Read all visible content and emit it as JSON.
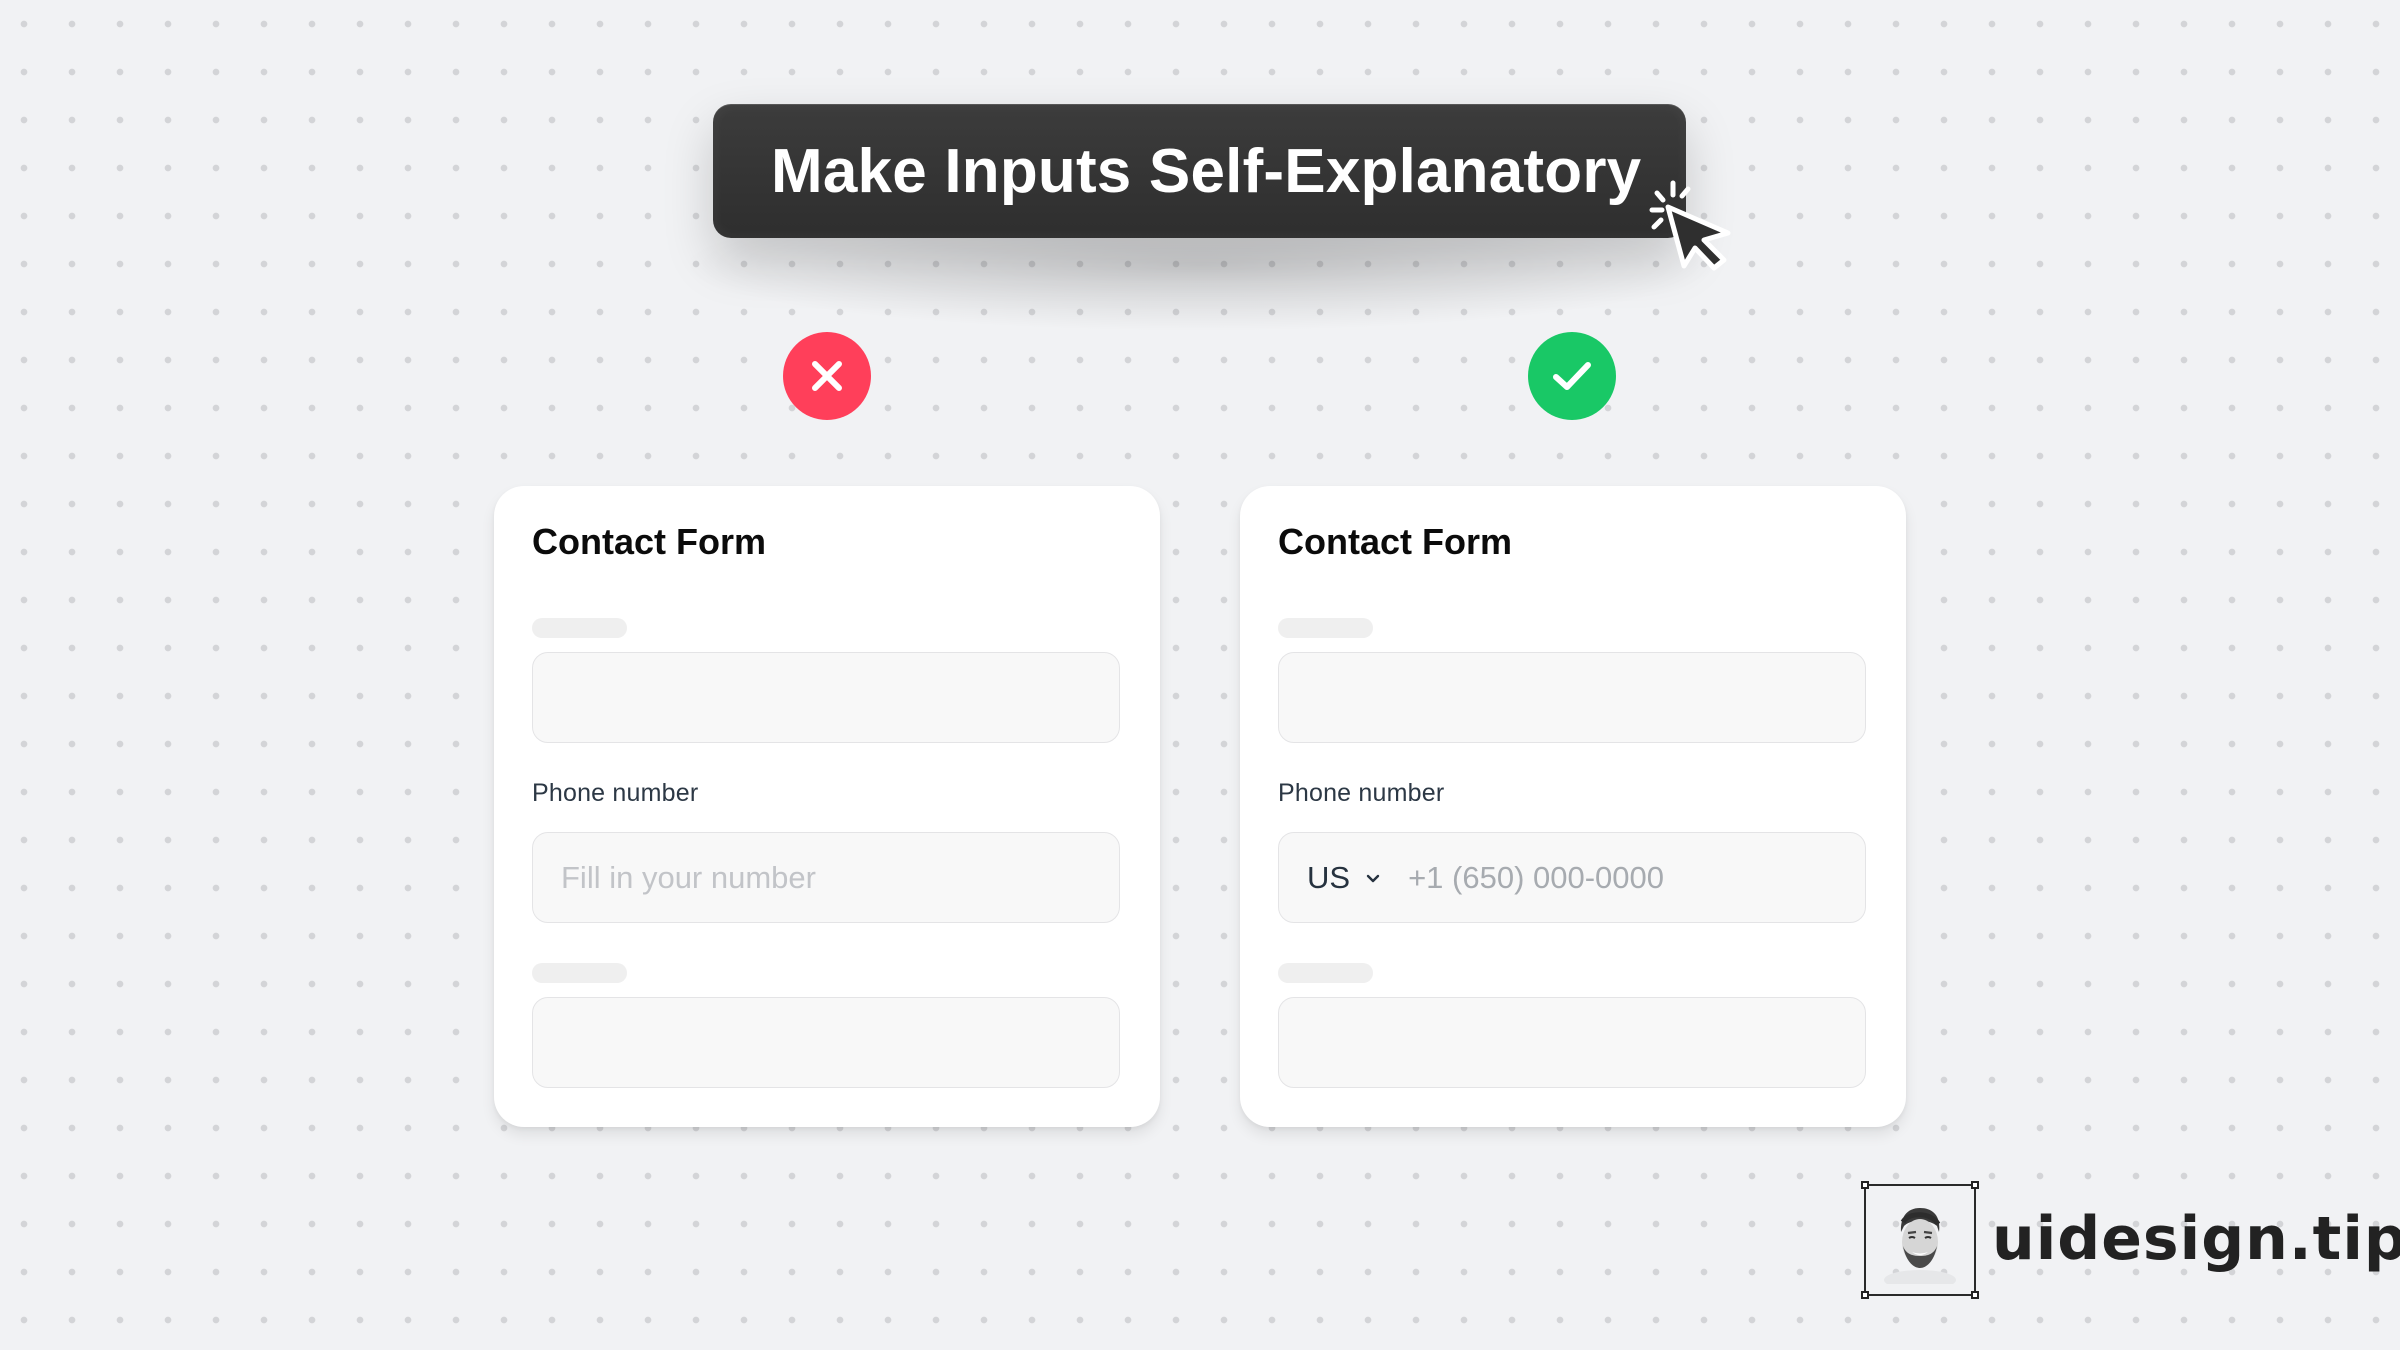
{
  "banner": {
    "title": "Make Inputs Self-Explanatory",
    "cursor_icon": "pointer-click-icon"
  },
  "badges": {
    "bad": {
      "icon": "x-icon",
      "meaning": "incorrect",
      "color": "#ff3f5a"
    },
    "good": {
      "icon": "check-icon",
      "meaning": "correct",
      "color": "#19c866"
    }
  },
  "forms": {
    "bad": {
      "title": "Contact Form",
      "phone_label": "Phone number",
      "phone_placeholder": "Fill in your number"
    },
    "good": {
      "title": "Contact Form",
      "phone_label": "Phone number",
      "country_code": "US",
      "phone_placeholder": "+1 (650) 000-0000"
    }
  },
  "brand": {
    "name": "uidesign.tips",
    "avatar_icon": "author-avatar"
  },
  "colors": {
    "background": "#f1f2f4",
    "banner": "#333333",
    "error": "#ff3f5a",
    "success": "#19c866"
  }
}
